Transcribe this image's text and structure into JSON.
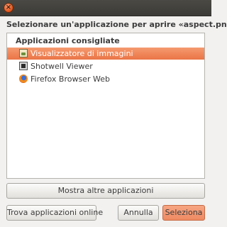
{
  "titlebar": {
    "close_glyph": "×",
    "close_icon": "close-icon"
  },
  "dialog": {
    "heading": "Selezionare un'applicazione per aprire «aspect.png»"
  },
  "list": {
    "header": "Applicazioni consigliate",
    "items": [
      {
        "label": "Visualizzatore di immagini",
        "icon": "image-viewer-icon",
        "selected": true
      },
      {
        "label": "Shotwell Viewer",
        "icon": "shotwell-icon",
        "selected": false
      },
      {
        "label": "Firefox Browser Web",
        "icon": "firefox-icon",
        "selected": false
      }
    ]
  },
  "buttons": {
    "show_more": "Mostra altre applicazioni",
    "find_online": "Trova applicazioni online",
    "cancel": "Annulla",
    "select": "Seleziona"
  },
  "colors": {
    "selection": "#ea7446",
    "suggested_button": "#ee8a62",
    "titlebar": "#3c3b37"
  }
}
